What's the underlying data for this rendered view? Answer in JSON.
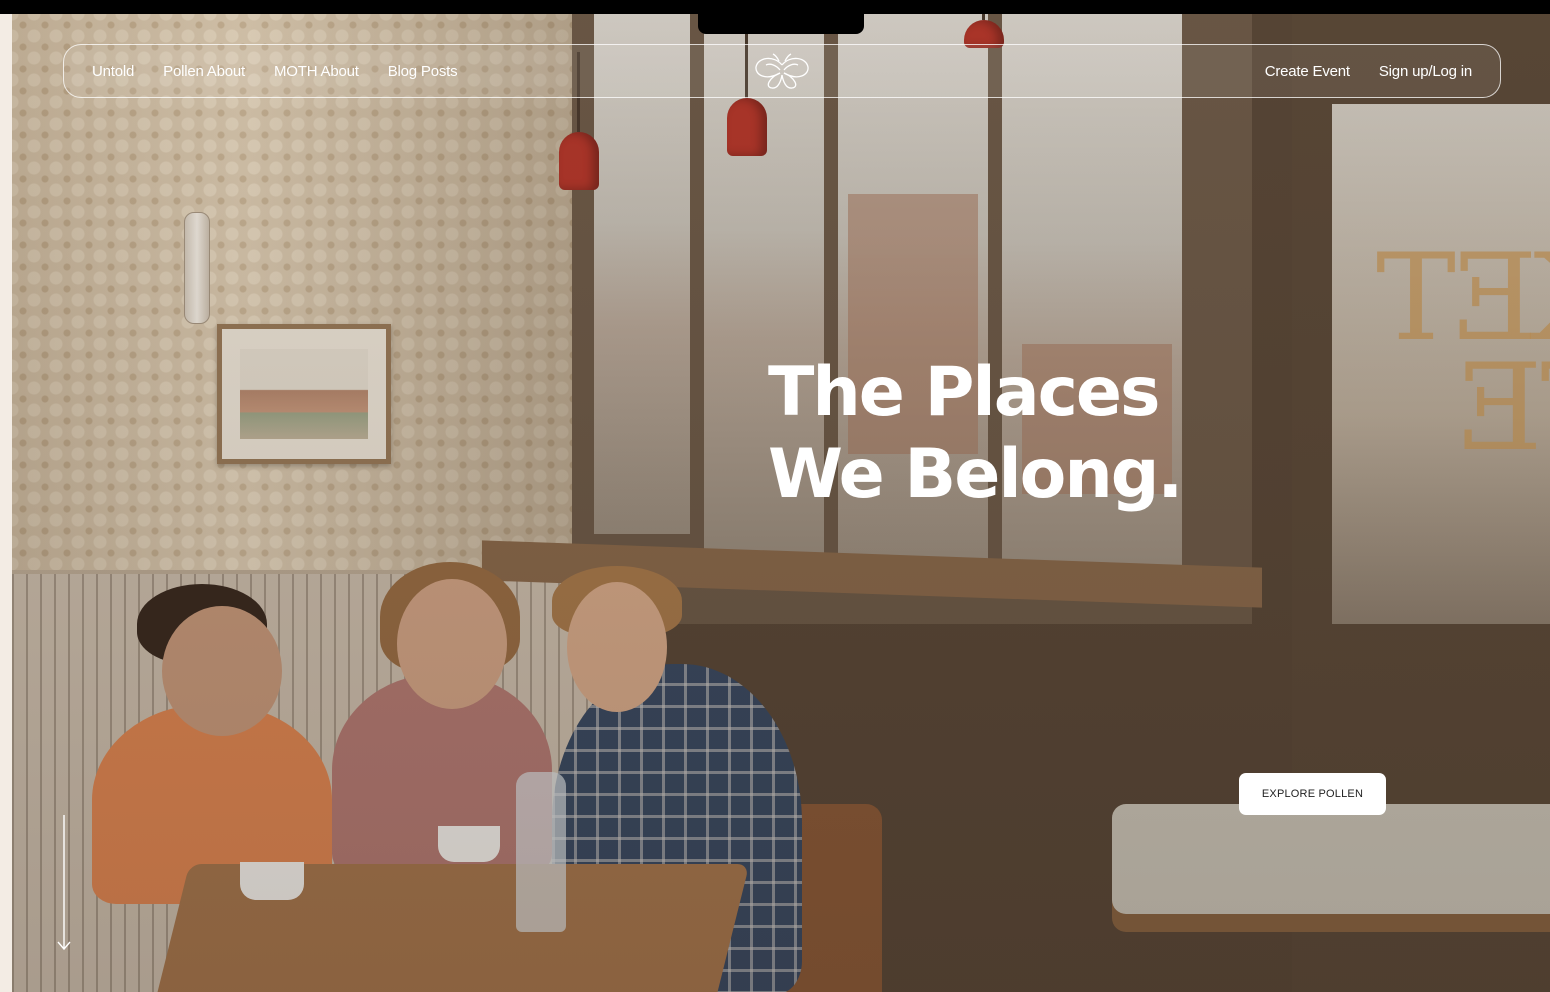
{
  "nav": {
    "left_links": [
      {
        "label": "Untold"
      },
      {
        "label": "Pollen About"
      },
      {
        "label": "MOTH About"
      },
      {
        "label": "Blog Posts"
      }
    ],
    "right_links": [
      {
        "label": "Create Event"
      },
      {
        "label": "Sign up/Log in"
      }
    ],
    "logo_icon": "moth-wings-icon"
  },
  "hero": {
    "headline_line1": "The Places",
    "headline_line2": "We Belong.",
    "cta_label": "EXPLORE POLLEN",
    "scroll_icon": "arrow-down-icon",
    "background": "cafe-photo"
  },
  "colors": {
    "nav_text": "#ffffff",
    "cta_bg": "#ffffff",
    "cta_text": "#222222",
    "left_strip": "#f3ece4"
  }
}
